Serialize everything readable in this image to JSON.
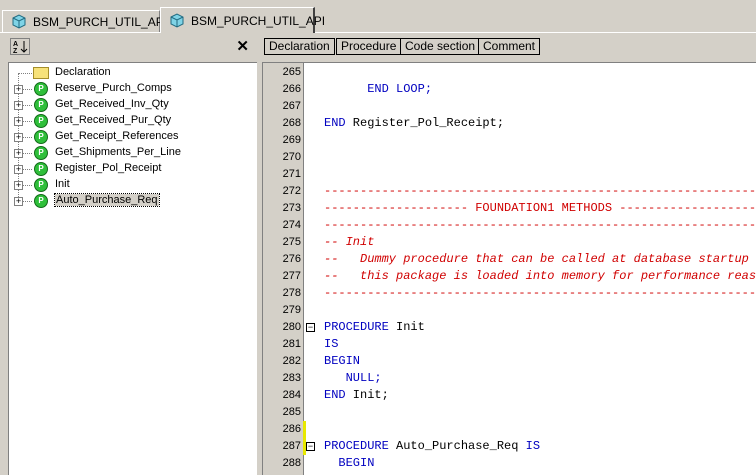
{
  "tabs": [
    {
      "label": "BSM_PURCH_UTIL_API",
      "active": false
    },
    {
      "label": "BSM_PURCH_UTIL_API",
      "active": true
    }
  ],
  "left_panel": {
    "sort_icon_text": "A↓Z",
    "close_label": "✕",
    "tree": [
      {
        "label": "Declaration",
        "type": "folder"
      },
      {
        "label": "Reserve_Purch_Comps",
        "type": "procedure"
      },
      {
        "label": "Get_Received_Inv_Qty",
        "type": "procedure"
      },
      {
        "label": "Get_Received_Pur_Qty",
        "type": "procedure"
      },
      {
        "label": "Get_Receipt_References",
        "type": "procedure"
      },
      {
        "label": "Get_Shipments_Per_Line",
        "type": "procedure"
      },
      {
        "label": "Register_Pol_Receipt",
        "type": "procedure"
      },
      {
        "label": "Init",
        "type": "procedure"
      },
      {
        "label": "Auto_Purchase_Req",
        "type": "procedure",
        "selected": true
      }
    ],
    "procedure_icon_letter": "P",
    "expander_symbol": "+"
  },
  "toolbar": {
    "buttons": [
      "Declaration",
      "Procedure",
      "Code section",
      "Comment"
    ]
  },
  "editor": {
    "lines": [
      {
        "no": "265",
        "text": "",
        "style": "plain"
      },
      {
        "no": "266",
        "text": "      END LOOP;",
        "style": "kw"
      },
      {
        "no": "267",
        "text": "",
        "style": "plain"
      },
      {
        "no": "268",
        "text_kw": "END",
        "text_rest": " Register_Pol_Receipt;",
        "style": "mixed"
      },
      {
        "no": "269",
        "text": "",
        "style": "plain"
      },
      {
        "no": "270",
        "text": "",
        "style": "plain"
      },
      {
        "no": "271",
        "text": "",
        "style": "plain"
      },
      {
        "no": "272",
        "text": "-----------------------------------------------------------------",
        "style": "cm"
      },
      {
        "no": "273",
        "text": "-------------------- FOUNDATION1 METHODS ------------------------",
        "style": "cm"
      },
      {
        "no": "274",
        "text": "-----------------------------------------------------------------",
        "style": "cm"
      },
      {
        "no": "275",
        "text": "-- Init",
        "style": "cmi"
      },
      {
        "no": "276",
        "text": "--   Dummy procedure that can be called at database startup to ensure that",
        "style": "cmi"
      },
      {
        "no": "277",
        "text": "--   this package is loaded into memory for performance reasons only.",
        "style": "cmi"
      },
      {
        "no": "278",
        "text": "-----------------------------------------------------------------",
        "style": "cm"
      },
      {
        "no": "279",
        "text": "",
        "style": "plain"
      },
      {
        "no": "280",
        "text_kw": "PROCEDURE",
        "text_rest": " Init",
        "style": "mixed",
        "fold": true
      },
      {
        "no": "281",
        "text": "IS",
        "style": "kw"
      },
      {
        "no": "282",
        "text": "BEGIN",
        "style": "kw"
      },
      {
        "no": "283",
        "text": "   NULL;",
        "style": "kw"
      },
      {
        "no": "284",
        "text_kw": "END",
        "text_rest": " Init;",
        "style": "mixed"
      },
      {
        "no": "285",
        "text": "",
        "style": "plain"
      },
      {
        "no": "286",
        "text": "",
        "style": "plain",
        "changed": true
      },
      {
        "no": "287",
        "text_kw": "PROCEDURE",
        "text_rest": " Auto_Purchase_Req ",
        "text_kw2": "IS",
        "style": "mixed2",
        "fold": true,
        "changed": true
      },
      {
        "no": "288",
        "text": "  BEGIN",
        "style": "kw"
      }
    ],
    "fold_symbol": "−"
  }
}
